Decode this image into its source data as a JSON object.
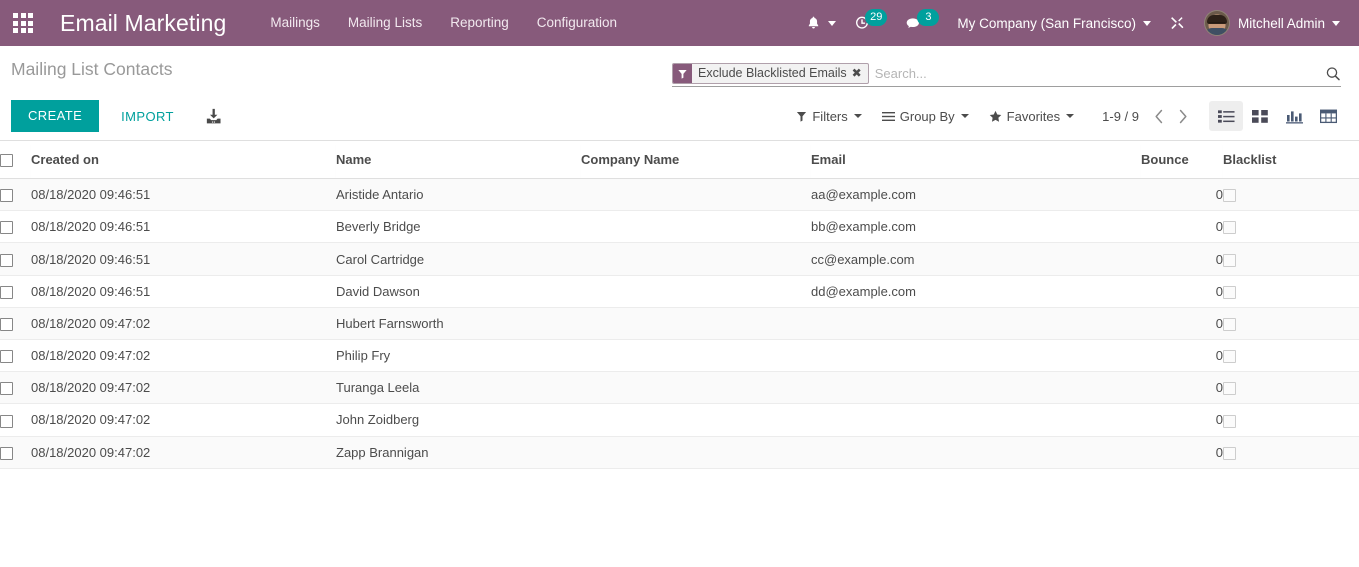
{
  "navbar": {
    "apps_icon": "apps-grid-icon",
    "brand": "Email Marketing",
    "menus": [
      {
        "label": "Mailings"
      },
      {
        "label": "Mailing Lists"
      },
      {
        "label": "Reporting"
      },
      {
        "label": "Configuration"
      }
    ],
    "systray": {
      "bell_icon": "bell-icon",
      "activity_icon": "clock-activity-icon",
      "activity_count": "29",
      "messages_icon": "speech-bubble-icon",
      "messages_count": "3",
      "company": "My Company (San Francisco)",
      "debug_icon": "developer-tools-icon",
      "avatar_icon": "user-avatar",
      "user": "Mitchell Admin"
    }
  },
  "control_panel": {
    "breadcrumb": "Mailing List Contacts",
    "search": {
      "facet": {
        "icon": "filter-funnel-icon",
        "label": "Exclude Blacklisted Emails",
        "remove": "✖"
      },
      "placeholder": "Search...",
      "value": "",
      "search_icon": "search-magnifier-icon"
    },
    "buttons": {
      "create": "CREATE",
      "import": "IMPORT",
      "export_icon": "download-export-icon"
    },
    "filters": {
      "label": "Filters",
      "icon": "funnel-icon"
    },
    "group_by": {
      "label": "Group By",
      "icon": "hamburger-icon"
    },
    "favorites": {
      "label": "Favorites",
      "icon": "star-icon"
    },
    "pager": {
      "value": "1-9 / 9",
      "prev_icon": "chevron-left-icon",
      "next_icon": "chevron-right-icon"
    },
    "views": [
      {
        "name": "list",
        "icon": "list-view-icon",
        "active": true
      },
      {
        "name": "kanban",
        "icon": "kanban-view-icon",
        "active": false
      },
      {
        "name": "graph",
        "icon": "graph-view-icon",
        "active": false
      },
      {
        "name": "pivot",
        "icon": "pivot-view-icon",
        "active": false
      }
    ]
  },
  "table": {
    "columns": [
      "Created on",
      "Name",
      "Company Name",
      "Email",
      "Bounce",
      "Blacklist"
    ],
    "rows": [
      {
        "created_on": "08/18/2020 09:46:51",
        "name": "Aristide Antario",
        "company": "",
        "email": "aa@example.com",
        "bounce": "0",
        "blacklist": false
      },
      {
        "created_on": "08/18/2020 09:46:51",
        "name": "Beverly Bridge",
        "company": "",
        "email": "bb@example.com",
        "bounce": "0",
        "blacklist": false
      },
      {
        "created_on": "08/18/2020 09:46:51",
        "name": "Carol Cartridge",
        "company": "",
        "email": "cc@example.com",
        "bounce": "0",
        "blacklist": false
      },
      {
        "created_on": "08/18/2020 09:46:51",
        "name": "David Dawson",
        "company": "",
        "email": "dd@example.com",
        "bounce": "0",
        "blacklist": false
      },
      {
        "created_on": "08/18/2020 09:47:02",
        "name": "Hubert Farnsworth",
        "company": "",
        "email": "",
        "bounce": "0",
        "blacklist": false
      },
      {
        "created_on": "08/18/2020 09:47:02",
        "name": "Philip Fry",
        "company": "",
        "email": "",
        "bounce": "0",
        "blacklist": false
      },
      {
        "created_on": "08/18/2020 09:47:02",
        "name": "Turanga Leela",
        "company": "",
        "email": "",
        "bounce": "0",
        "blacklist": false
      },
      {
        "created_on": "08/18/2020 09:47:02",
        "name": "John Zoidberg",
        "company": "",
        "email": "",
        "bounce": "0",
        "blacklist": false
      },
      {
        "created_on": "08/18/2020 09:47:02",
        "name": "Zapp Brannigan",
        "company": "",
        "email": "",
        "bounce": "0",
        "blacklist": false
      }
    ]
  },
  "colors": {
    "brand_purple": "#875A7B",
    "accent_teal": "#00A09D",
    "text": "#4c4c4c",
    "muted": "#999999",
    "row_stripe": "#fafafa",
    "border": "#dfdfdf"
  }
}
